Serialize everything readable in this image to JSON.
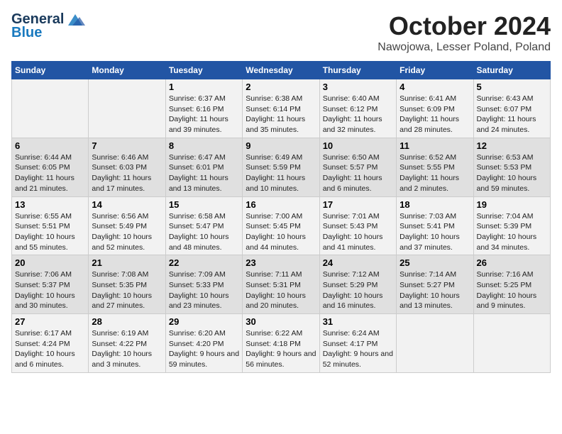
{
  "logo": {
    "line1": "General",
    "line2": "Blue"
  },
  "title": "October 2024",
  "location": "Nawojowa, Lesser Poland, Poland",
  "days_of_week": [
    "Sunday",
    "Monday",
    "Tuesday",
    "Wednesday",
    "Thursday",
    "Friday",
    "Saturday"
  ],
  "weeks": [
    [
      {
        "day": "",
        "info": ""
      },
      {
        "day": "",
        "info": ""
      },
      {
        "day": "1",
        "info": "Sunrise: 6:37 AM\nSunset: 6:16 PM\nDaylight: 11 hours and 39 minutes."
      },
      {
        "day": "2",
        "info": "Sunrise: 6:38 AM\nSunset: 6:14 PM\nDaylight: 11 hours and 35 minutes."
      },
      {
        "day": "3",
        "info": "Sunrise: 6:40 AM\nSunset: 6:12 PM\nDaylight: 11 hours and 32 minutes."
      },
      {
        "day": "4",
        "info": "Sunrise: 6:41 AM\nSunset: 6:09 PM\nDaylight: 11 hours and 28 minutes."
      },
      {
        "day": "5",
        "info": "Sunrise: 6:43 AM\nSunset: 6:07 PM\nDaylight: 11 hours and 24 minutes."
      }
    ],
    [
      {
        "day": "6",
        "info": "Sunrise: 6:44 AM\nSunset: 6:05 PM\nDaylight: 11 hours and 21 minutes."
      },
      {
        "day": "7",
        "info": "Sunrise: 6:46 AM\nSunset: 6:03 PM\nDaylight: 11 hours and 17 minutes."
      },
      {
        "day": "8",
        "info": "Sunrise: 6:47 AM\nSunset: 6:01 PM\nDaylight: 11 hours and 13 minutes."
      },
      {
        "day": "9",
        "info": "Sunrise: 6:49 AM\nSunset: 5:59 PM\nDaylight: 11 hours and 10 minutes."
      },
      {
        "day": "10",
        "info": "Sunrise: 6:50 AM\nSunset: 5:57 PM\nDaylight: 11 hours and 6 minutes."
      },
      {
        "day": "11",
        "info": "Sunrise: 6:52 AM\nSunset: 5:55 PM\nDaylight: 11 hours and 2 minutes."
      },
      {
        "day": "12",
        "info": "Sunrise: 6:53 AM\nSunset: 5:53 PM\nDaylight: 10 hours and 59 minutes."
      }
    ],
    [
      {
        "day": "13",
        "info": "Sunrise: 6:55 AM\nSunset: 5:51 PM\nDaylight: 10 hours and 55 minutes."
      },
      {
        "day": "14",
        "info": "Sunrise: 6:56 AM\nSunset: 5:49 PM\nDaylight: 10 hours and 52 minutes."
      },
      {
        "day": "15",
        "info": "Sunrise: 6:58 AM\nSunset: 5:47 PM\nDaylight: 10 hours and 48 minutes."
      },
      {
        "day": "16",
        "info": "Sunrise: 7:00 AM\nSunset: 5:45 PM\nDaylight: 10 hours and 44 minutes."
      },
      {
        "day": "17",
        "info": "Sunrise: 7:01 AM\nSunset: 5:43 PM\nDaylight: 10 hours and 41 minutes."
      },
      {
        "day": "18",
        "info": "Sunrise: 7:03 AM\nSunset: 5:41 PM\nDaylight: 10 hours and 37 minutes."
      },
      {
        "day": "19",
        "info": "Sunrise: 7:04 AM\nSunset: 5:39 PM\nDaylight: 10 hours and 34 minutes."
      }
    ],
    [
      {
        "day": "20",
        "info": "Sunrise: 7:06 AM\nSunset: 5:37 PM\nDaylight: 10 hours and 30 minutes."
      },
      {
        "day": "21",
        "info": "Sunrise: 7:08 AM\nSunset: 5:35 PM\nDaylight: 10 hours and 27 minutes."
      },
      {
        "day": "22",
        "info": "Sunrise: 7:09 AM\nSunset: 5:33 PM\nDaylight: 10 hours and 23 minutes."
      },
      {
        "day": "23",
        "info": "Sunrise: 7:11 AM\nSunset: 5:31 PM\nDaylight: 10 hours and 20 minutes."
      },
      {
        "day": "24",
        "info": "Sunrise: 7:12 AM\nSunset: 5:29 PM\nDaylight: 10 hours and 16 minutes."
      },
      {
        "day": "25",
        "info": "Sunrise: 7:14 AM\nSunset: 5:27 PM\nDaylight: 10 hours and 13 minutes."
      },
      {
        "day": "26",
        "info": "Sunrise: 7:16 AM\nSunset: 5:25 PM\nDaylight: 10 hours and 9 minutes."
      }
    ],
    [
      {
        "day": "27",
        "info": "Sunrise: 6:17 AM\nSunset: 4:24 PM\nDaylight: 10 hours and 6 minutes."
      },
      {
        "day": "28",
        "info": "Sunrise: 6:19 AM\nSunset: 4:22 PM\nDaylight: 10 hours and 3 minutes."
      },
      {
        "day": "29",
        "info": "Sunrise: 6:20 AM\nSunset: 4:20 PM\nDaylight: 9 hours and 59 minutes."
      },
      {
        "day": "30",
        "info": "Sunrise: 6:22 AM\nSunset: 4:18 PM\nDaylight: 9 hours and 56 minutes."
      },
      {
        "day": "31",
        "info": "Sunrise: 6:24 AM\nSunset: 4:17 PM\nDaylight: 9 hours and 52 minutes."
      },
      {
        "day": "",
        "info": ""
      },
      {
        "day": "",
        "info": ""
      }
    ]
  ]
}
